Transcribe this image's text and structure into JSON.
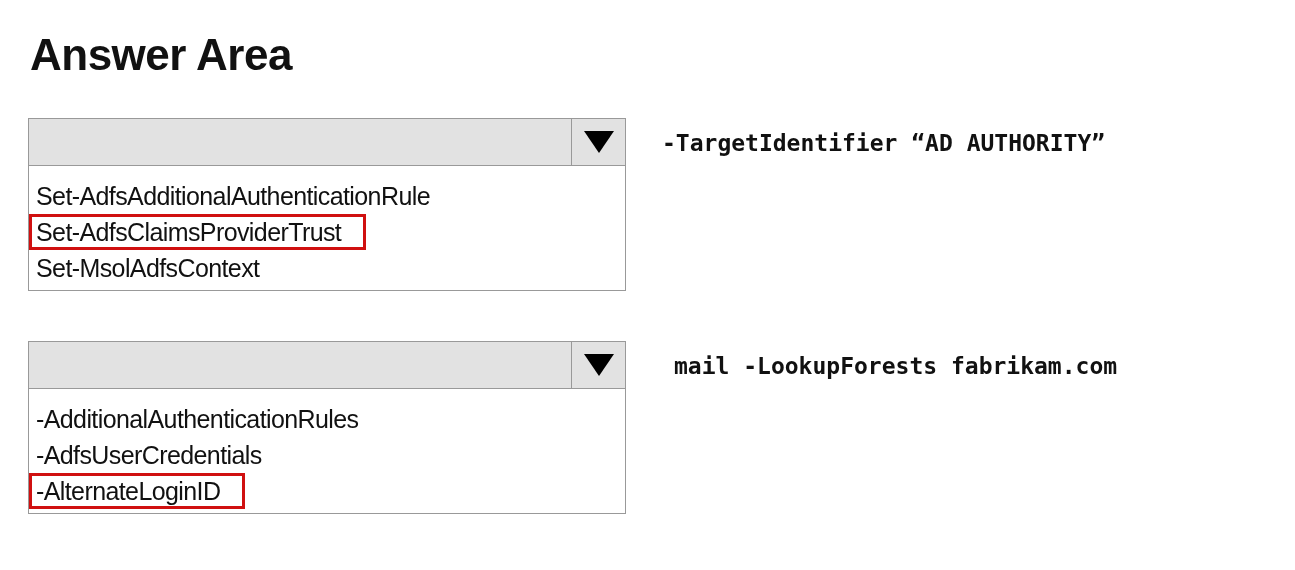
{
  "title": "Answer Area",
  "questions": [
    {
      "options": [
        {
          "label": "Set-AdfsAdditionalAuthenticationRule",
          "selected": false
        },
        {
          "label": "Set-AdfsClaimsProviderTrust",
          "selected": true
        },
        {
          "label": "Set-MsolAdfsContext",
          "selected": false
        }
      ],
      "suffix": "-TargetIdentifier “AD AUTHORITY”"
    },
    {
      "options": [
        {
          "label": "-AdditionalAuthenticationRules",
          "selected": false
        },
        {
          "label": "-AdfsUserCredentials",
          "selected": false
        },
        {
          "label": "-AlternateLoginID",
          "selected": true
        }
      ],
      "suffix": "mail -LookupForests fabrikam.com"
    }
  ]
}
